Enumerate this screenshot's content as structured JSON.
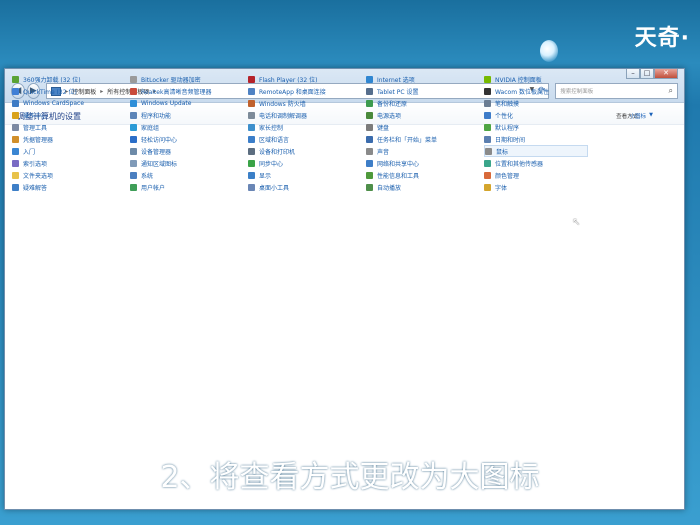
{
  "watermark": "天奇·",
  "window": {
    "nav": {
      "back_icon": "back-arrow-icon",
      "forward_icon": "forward-arrow-icon",
      "recent_icon": "chevron-down-icon"
    },
    "address": {
      "crumbs": [
        "控制面板",
        "所有控制面板项"
      ],
      "separator": "▸"
    },
    "search_placeholder": "搜索控制面板",
    "title": "调整计算机的设置",
    "view_by_label": "查看方式:",
    "view_by_value": "小图标",
    "items": [
      {
        "label": "360强力卸载 (32 位)",
        "color": "#5aa335"
      },
      {
        "label": "QuickTime (32 位)",
        "color": "#3f7fd6"
      },
      {
        "label": "Windows CardSpace",
        "color": "#3d7bc4"
      },
      {
        "label": "操作中心",
        "color": "#d9a21b"
      },
      {
        "label": "管理工具",
        "color": "#7c8aa3"
      },
      {
        "label": "凭据管理器",
        "color": "#d18f2a"
      },
      {
        "label": "入门",
        "color": "#3a86d2"
      },
      {
        "label": "索引选项",
        "color": "#7a6bc4"
      },
      {
        "label": "文件夹选项",
        "color": "#e8c24a"
      },
      {
        "label": "疑难解答",
        "color": "#3e7fc7"
      },
      {
        "label": "BitLocker 驱动器加密",
        "color": "#9a9a9a"
      },
      {
        "label": "Realtek高清晰音频管理器",
        "color": "#c94a3a"
      },
      {
        "label": "Windows Update",
        "color": "#2f8fd8"
      },
      {
        "label": "程序和功能",
        "color": "#5d85b8"
      },
      {
        "label": "家庭组",
        "color": "#2c9bd6"
      },
      {
        "label": "轻松访问中心",
        "color": "#2b6ec8"
      },
      {
        "label": "设备管理器",
        "color": "#6d8aa8"
      },
      {
        "label": "通知区域图标",
        "color": "#7f9ab8"
      },
      {
        "label": "系统",
        "color": "#4b7fc0"
      },
      {
        "label": "用户帐户",
        "color": "#3f9e58"
      },
      {
        "label": "Flash Player (32 位)",
        "color": "#b5232b"
      },
      {
        "label": "RemoteApp 和桌面连接",
        "color": "#4f82c3"
      },
      {
        "label": "Windows 防火墙",
        "color": "#c0612c"
      },
      {
        "label": "电话和调制解调器",
        "color": "#7d8b99"
      },
      {
        "label": "家长控制",
        "color": "#3d8fcc"
      },
      {
        "label": "区域和语言",
        "color": "#3b7ec9"
      },
      {
        "label": "设备和打印机",
        "color": "#5c6d80"
      },
      {
        "label": "同步中心",
        "color": "#3aa347"
      },
      {
        "label": "显示",
        "color": "#3b7fc7"
      },
      {
        "label": "桌面小工具",
        "color": "#6a86b5"
      },
      {
        "label": "Internet 选项",
        "color": "#2f86d1"
      },
      {
        "label": "Tablet PC 设置",
        "color": "#566e8c"
      },
      {
        "label": "备份和还原",
        "color": "#3d9b4f"
      },
      {
        "label": "电源选项",
        "color": "#4b8a3c"
      },
      {
        "label": "键盘",
        "color": "#7c7c7c"
      },
      {
        "label": "任务栏和「开始」菜单",
        "color": "#3b6cad"
      },
      {
        "label": "声音",
        "color": "#8a8a8a"
      },
      {
        "label": "网络和共享中心",
        "color": "#3e7ec7"
      },
      {
        "label": "性能信息和工具",
        "color": "#4f9a3b"
      },
      {
        "label": "自动播放",
        "color": "#4e8f4a"
      },
      {
        "label": "NVIDIA 控制面板",
        "color": "#76b900"
      },
      {
        "label": "Wacom 数位板属性",
        "color": "#333333"
      },
      {
        "label": "笔和触摸",
        "color": "#6b7d93"
      },
      {
        "label": "个性化",
        "color": "#3e7cc9"
      },
      {
        "label": "默认程序",
        "color": "#4fa543"
      },
      {
        "label": "日期和时间",
        "color": "#5b7fb0"
      },
      {
        "label": "鼠标",
        "color": "#8a8a8a"
      },
      {
        "label": "位置和其他传感器",
        "color": "#3aa58a"
      },
      {
        "label": "颜色管理",
        "color": "#d86a3a"
      },
      {
        "label": "字体",
        "color": "#d4a52c"
      }
    ]
  },
  "caption": "2、将查看方式更改为大图标"
}
